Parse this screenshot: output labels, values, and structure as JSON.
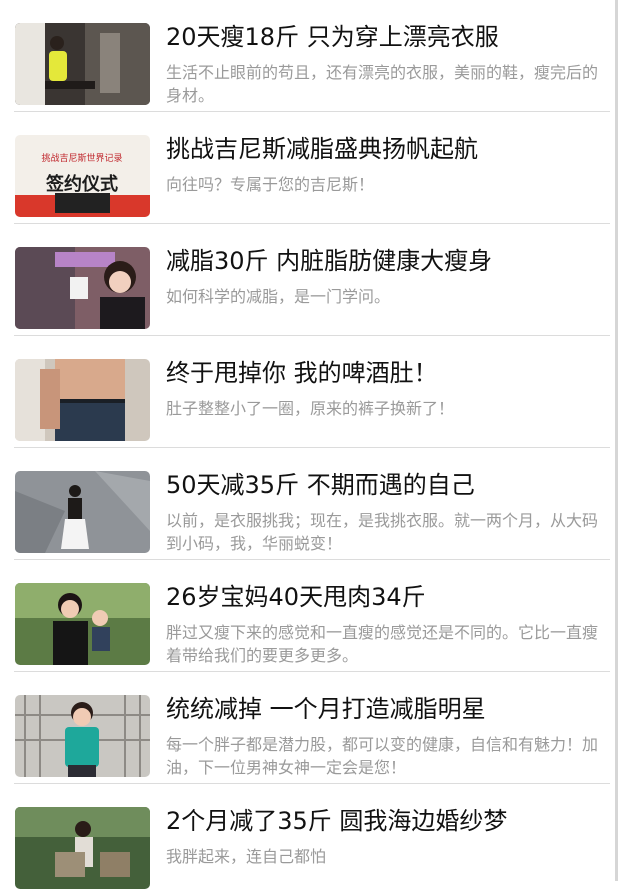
{
  "articles": [
    {
      "title": "20天瘦18斤 只为穿上漂亮衣服",
      "description": "生活不止眼前的苟且，还有漂亮的衣服，美丽的鞋，瘦完后的身材。"
    },
    {
      "title": "挑战吉尼斯减脂盛典扬帆起航",
      "description": "向往吗？专属于您的吉尼斯！",
      "thumbnail_text": [
        "挑战吉尼斯世界记录",
        "签约仪式"
      ]
    },
    {
      "title": "减脂30斤 内脏脂肪健康大瘦身",
      "description": "如何科学的减脂，是一门学问。"
    },
    {
      "title": "终于甩掉你 我的啤酒肚！",
      "description": "肚子整整小了一圈，原来的裤子换新了！"
    },
    {
      "title": "50天减35斤 不期而遇的自己",
      "description": "以前，是衣服挑我；现在，是我挑衣服。就一两个月，从大码到小码，我，华丽蜕变！"
    },
    {
      "title": "26岁宝妈40天甩肉34斤",
      "description": "胖过又瘦下来的感觉和一直瘦的感觉还是不同的。它比一直瘦着带给我们的要更多更多。"
    },
    {
      "title": "统统减掉 一个月打造减脂明星",
      "description": "每一个胖子都是潜力股，都可以变的健康，自信和有魅力！加油，下一位男神女神一定会是您！"
    },
    {
      "title": "2个月减了35斤 圆我海边婚纱梦",
      "description": "我胖起来，连自己都怕"
    }
  ]
}
